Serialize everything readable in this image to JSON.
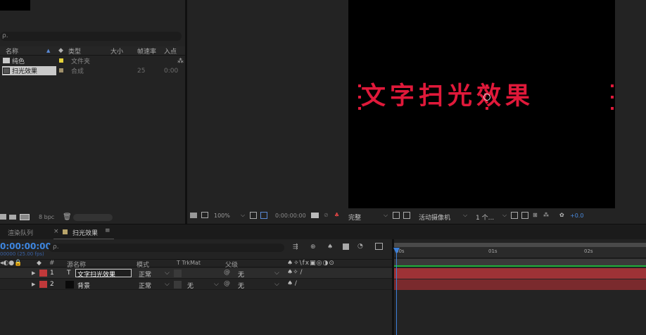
{
  "project": {
    "search_placeholder": "ρ.",
    "columns": [
      "名称",
      "类型",
      "大小",
      "帧速率",
      "入点"
    ],
    "items": [
      {
        "name": "纯色",
        "type": "文件夹",
        "size": "",
        "fps": "",
        "in": "",
        "label_color": "#e5d23a",
        "kind": "folder"
      },
      {
        "name": "扫光效果",
        "type": "合成",
        "size": "",
        "fps": "25",
        "in": "0:00",
        "label_color": "#a0906a",
        "kind": "comp",
        "selected": true
      }
    ],
    "bpc": "8 bpc"
  },
  "viewer": {
    "comp_text": "文字扫光效果",
    "text_color": "#e0193a",
    "zoom": "100%",
    "timecode": "0:00:00:00",
    "quality": "完整",
    "camera": "活动摄像机",
    "views": "1 个...",
    "exposure": "+0.0"
  },
  "tabs": {
    "render_queue": "渲染队列",
    "comp_tab": "扫光效果",
    "menu_glyph": "≡",
    "close_glyph": "×"
  },
  "timeline": {
    "timecode": "0:00:00:00",
    "fps_info": "00000 (25.00 fps)",
    "search_placeholder": "ρ.",
    "col_hash": "#",
    "col_source": "源名称",
    "col_mode": "模式",
    "col_trkmat": "T  TrkMat",
    "col_parent": "父级",
    "ruler": [
      "00s",
      "01s",
      "02s"
    ],
    "layers": [
      {
        "num": "1",
        "type_glyph": "T",
        "name": "文字扫光效果",
        "mode": "正常",
        "trkmat": "",
        "parent": "无",
        "label_color": "#c0393a",
        "swatch": "#111111",
        "selected": true
      },
      {
        "num": "2",
        "type_glyph": "",
        "name": "背景",
        "mode": "正常",
        "trkmat": "无",
        "parent": "无",
        "label_color": "#c0393a",
        "swatch": "#0a0a0a",
        "selected": false
      }
    ]
  }
}
